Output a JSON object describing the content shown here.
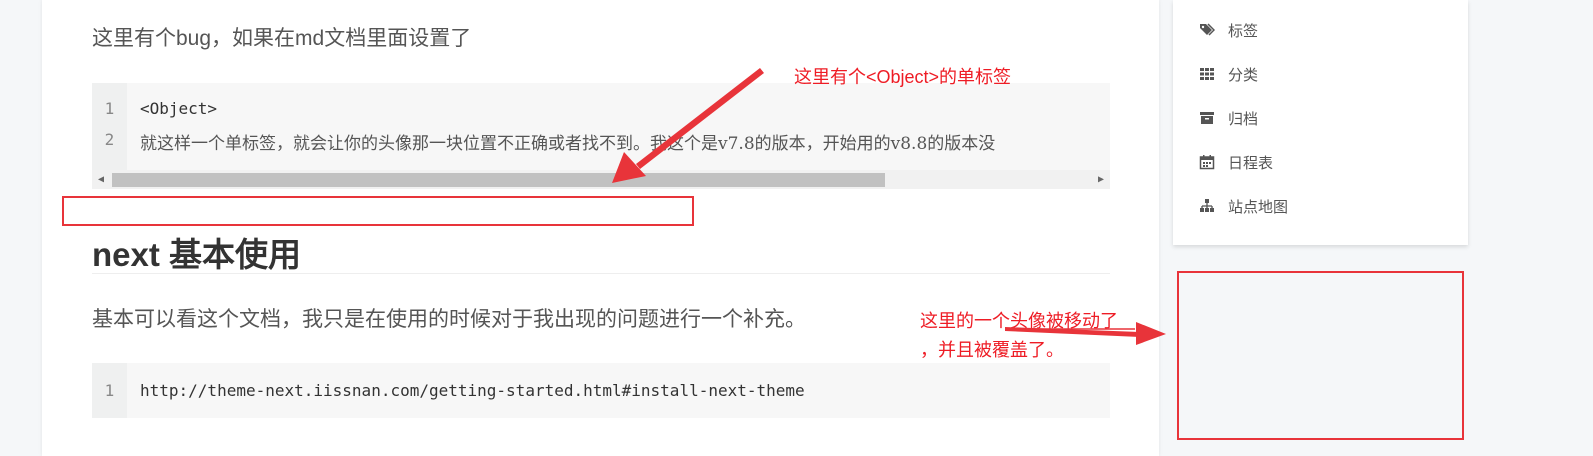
{
  "article": {
    "intro_text": "这里有个bug，如果在md文档里面设置了",
    "code_block_1": {
      "line_numbers": [
        "1",
        "2"
      ],
      "lines": [
        "<Object>",
        "就这样一个单标签，就会让你的头像那一块位置不正确或者找不到。我这个是v7.8的版本，开始用的v8.8的版本没"
      ],
      "scroll_left_arrow": "◀",
      "scroll_right_arrow": "▶"
    },
    "section_heading": "next 基本使用",
    "section_text": "基本可以看这个文档，我只是在使用的时候对于我出现的问题进行一个补充。",
    "code_block_2": {
      "line_numbers": [
        "1"
      ],
      "lines": [
        "http://theme-next.iissnan.com/getting-started.html#install-next-theme"
      ]
    }
  },
  "sidebar_menu": {
    "items": [
      {
        "label": "标签",
        "icon": "tags-icon"
      },
      {
        "label": "分类",
        "icon": "th-icon"
      },
      {
        "label": "归档",
        "icon": "archive-icon"
      },
      {
        "label": "日程表",
        "icon": "calendar-icon"
      },
      {
        "label": "站点地图",
        "icon": "sitemap-icon"
      }
    ]
  },
  "annotations": {
    "note_1": "这里有个<Object>的单标签",
    "note_2_line_1": "这里的一个头像被移动了",
    "note_2_line_2": "，并且被覆盖了。",
    "color": "#e8343a"
  }
}
